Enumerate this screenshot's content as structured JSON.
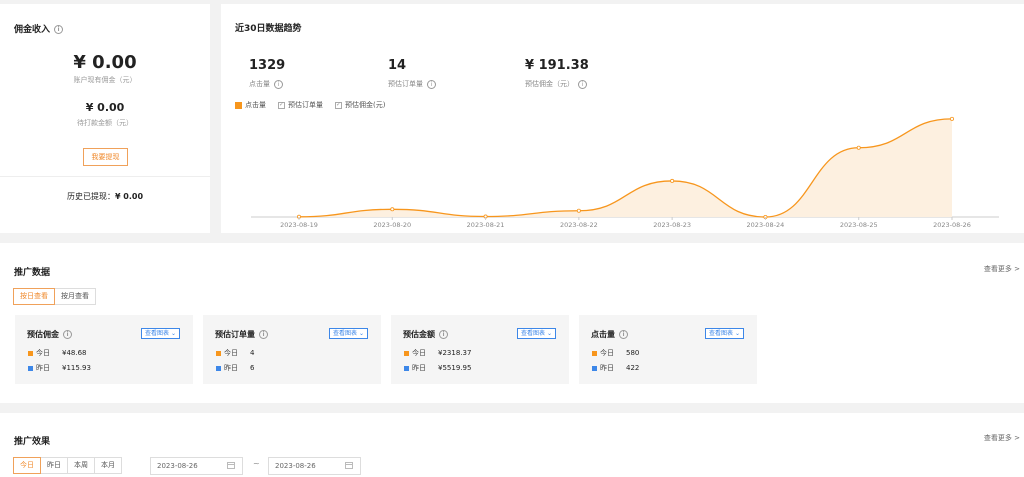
{
  "commission": {
    "title": "佣金收入",
    "balance": "¥ 0.00",
    "balance_label": "账户现有佣金（元）",
    "pending": "¥ 0.00",
    "pending_label": "待打款金额（元）",
    "withdraw_label": "我要提现",
    "history_label": "历史已提现：",
    "history_value": "¥ 0.00"
  },
  "trend": {
    "title": "近30日数据趋势",
    "kpis": [
      {
        "value": "1329",
        "label": "点击量"
      },
      {
        "value": "14",
        "label": "预估订单量"
      },
      {
        "value": "¥ 191.38",
        "label": "预估佣金（元）"
      }
    ],
    "legend": [
      {
        "label": "点击量",
        "checked": true
      },
      {
        "label": "预估订单量",
        "checked": false
      },
      {
        "label": "预估佣金(元)",
        "checked": false
      }
    ]
  },
  "chart_data": {
    "type": "area",
    "title": "",
    "categories": [
      "2023-08-19",
      "2023-08-20",
      "2023-08-21",
      "2023-08-22",
      "2023-08-23",
      "2023-08-24",
      "2023-08-25",
      "2023-08-26"
    ],
    "series": [
      {
        "name": "点击量",
        "values": [
          2,
          80,
          5,
          65,
          375,
          0,
          720,
          1020
        ]
      }
    ],
    "ylim": [
      0,
      1050
    ],
    "grid": false,
    "color": "#f7961d",
    "fill": "#fdf0e0"
  },
  "promo": {
    "title": "推广数据",
    "more_label": "查看更多",
    "view_tabs": [
      "按日查看",
      "按月查看"
    ],
    "metrics": [
      {
        "title": "预估佣金",
        "chart_btn": "查看图表",
        "today_label": "今日",
        "today": "¥48.68",
        "yesterday_label": "昨日",
        "yesterday": "¥115.93"
      },
      {
        "title": "预估订单量",
        "chart_btn": "查看图表",
        "today_label": "今日",
        "today": "4",
        "yesterday_label": "昨日",
        "yesterday": "6"
      },
      {
        "title": "预估金额",
        "chart_btn": "查看图表",
        "today_label": "今日",
        "today": "¥2318.37",
        "yesterday_label": "昨日",
        "yesterday": "¥5519.95"
      },
      {
        "title": "点击量",
        "chart_btn": "查看图表",
        "today_label": "今日",
        "today": "580",
        "yesterday_label": "昨日",
        "yesterday": "422"
      }
    ],
    "colors": {
      "today": "#f7961d",
      "yesterday": "#3d87e8"
    }
  },
  "effect": {
    "title": "推广效果",
    "more_label": "查看更多",
    "ranges": [
      "今日",
      "昨日",
      "本周",
      "本月"
    ],
    "date_from": "2023-08-26",
    "date_sep": "~",
    "date_to": "2023-08-26"
  }
}
